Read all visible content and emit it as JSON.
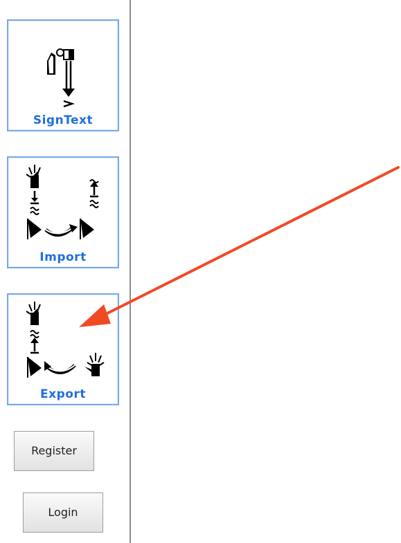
{
  "sidebar": {
    "buttons": [
      {
        "label": "SignText",
        "icon": "signtext-icon"
      },
      {
        "label": "Import",
        "icon": "import-icon"
      },
      {
        "label": "Export",
        "icon": "export-icon"
      }
    ],
    "register_label": "Register",
    "login_label": "Login"
  },
  "annotation": {
    "arrow_color": "#f04a23",
    "points_to": "Export"
  },
  "colors": {
    "accent": "#1f6fe0",
    "button_border": "#79a8e6"
  }
}
